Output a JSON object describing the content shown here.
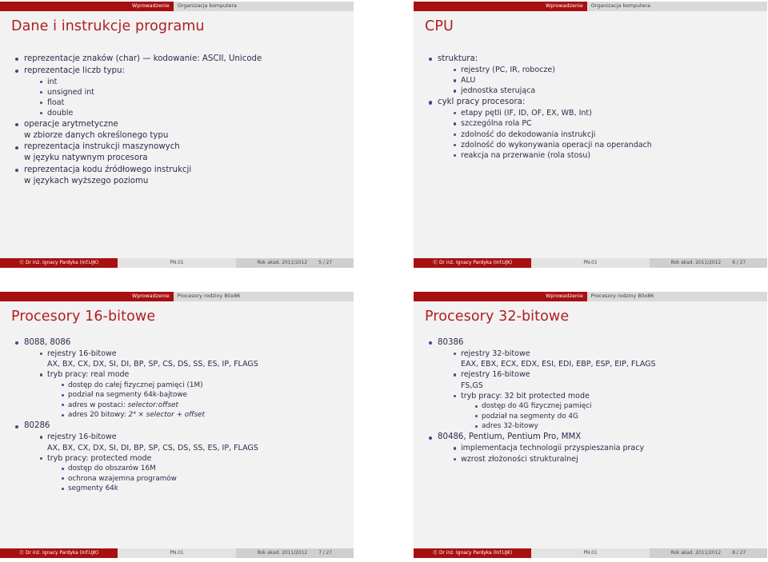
{
  "colors": {
    "accent_red": "#a81010",
    "title_red": "#b02020",
    "body_navy": "#2b2b4f",
    "bullet_navy": "#46468c",
    "slide_bg": "#f2f2f2",
    "page_bg": "#ffffff",
    "nav_inactive_bg": "#d9d9d9"
  },
  "footer_common": {
    "author": "Ⓒ Dr inż. Ignacy Pardyka  (Inf.UJK)",
    "short_title": "PN.01",
    "date": "Rok akad. 2011/2012"
  },
  "slides": [
    {
      "id": "slide-5",
      "nav": [
        {
          "label": "Wprowadzenie",
          "active": true
        },
        {
          "label": "Organizacja komputera",
          "active": false
        }
      ],
      "title": "Dane i instrukcje programu",
      "items": [
        {
          "text": "reprezentacje znaków (char) — kodowanie: ASCII, Unicode"
        },
        {
          "text": "reprezentacje liczb typu:",
          "children": [
            {
              "text": "int"
            },
            {
              "text": "unsigned int"
            },
            {
              "text": "float"
            },
            {
              "text": "double"
            }
          ]
        },
        {
          "text": "operacje arytmetyczne",
          "subline": "w zbiorze danych określonego typu"
        },
        {
          "text": "reprezentacja instrukcji maszynowych",
          "subline": "w języku natywnym procesora"
        },
        {
          "text": "reprezentacja kodu źródłowego instrukcji",
          "subline": "w językach wyższego poziomu"
        }
      ],
      "footer": {
        "page": "5 / 27"
      }
    },
    {
      "id": "slide-6",
      "nav": [
        {
          "label": "Wprowadzenie",
          "active": true
        },
        {
          "label": "Organizacja komputera",
          "active": false
        }
      ],
      "title": "CPU",
      "items": [
        {
          "text": "struktura:",
          "children": [
            {
              "text": "rejestry (PC, IR, robocze)"
            },
            {
              "text": "ALU"
            },
            {
              "text": "jednostka sterująca"
            }
          ]
        },
        {
          "text": "cykl pracy procesora:",
          "children": [
            {
              "text": "etapy pętli (IF, ID, OF, EX, WB, Int)"
            },
            {
              "text": "szczególna rola PC"
            },
            {
              "text": "zdolność do dekodowania instrukcji"
            },
            {
              "text": "zdolność do wykonywania operacji na operandach"
            },
            {
              "text": "reakcja na przerwanie (rola stosu)"
            }
          ]
        }
      ],
      "footer": {
        "page": "6 / 27"
      }
    },
    {
      "id": "slide-7",
      "nav": [
        {
          "label": "Wprowadzenie",
          "active": true
        },
        {
          "label": "Procesory rodziny 80x86",
          "active": false
        }
      ],
      "title": "Procesory 16-bitowe",
      "items": [
        {
          "text": "8088, 8086",
          "children": [
            {
              "text": "rejestry 16-bitowe",
              "subline": "AX, BX, CX, DX, SI, DI, BP, SP, CS, DS, SS, ES, IP, FLAGS"
            },
            {
              "text": "tryb pracy: real mode",
              "children": [
                {
                  "text": "dostęp do całej fizycznej pamięci (1M)"
                },
                {
                  "text": "podział na segmenty 64k-bajtowe"
                },
                {
                  "text": "adres w postaci: ",
                  "italic_tail": "selector:offset"
                },
                {
                  "text": "adres 20 bitowy: ",
                  "math": "2⁴ × selector + offset"
                }
              ]
            }
          ]
        },
        {
          "text": "80286",
          "children": [
            {
              "text": "rejestry 16-bitowe",
              "subline": "AX, BX, CX, DX, SI, DI, BP, SP, CS, DS, SS, ES, IP, FLAGS"
            },
            {
              "text": "tryb pracy: protected mode",
              "children": [
                {
                  "text": "dostęp do obszarów 16M"
                },
                {
                  "text": "ochrona wzajemna programów"
                },
                {
                  "text": "segmenty 64k"
                }
              ]
            }
          ]
        }
      ],
      "footer": {
        "page": "7 / 27"
      }
    },
    {
      "id": "slide-8",
      "nav": [
        {
          "label": "Wprowadzenie",
          "active": true
        },
        {
          "label": "Procesory rodziny 80x86",
          "active": false
        }
      ],
      "title": "Procesory 32-bitowe",
      "items": [
        {
          "text": "80386",
          "children": [
            {
              "text": "rejestry 32-bitowe",
              "subline": "EAX, EBX, ECX, EDX, ESI, EDI, EBP, ESP, EIP, FLAGS"
            },
            {
              "text": "rejestry 16-bitowe",
              "subline": "FS,GS"
            },
            {
              "text": "tryb pracy: 32 bit protected mode",
              "children": [
                {
                  "text": "dostęp do 4G fizycznej pamięci"
                },
                {
                  "text": "podział na segmenty do 4G"
                },
                {
                  "text": "adres 32-bitowy"
                }
              ]
            }
          ]
        },
        {
          "text": "80486, Pentium, Pentium Pro, MMX",
          "children": [
            {
              "text": "implementacja technologii przyspieszania pracy"
            },
            {
              "text": "wzrost złożoności strukturalnej"
            }
          ]
        }
      ],
      "footer": {
        "page": "8 / 27"
      }
    }
  ]
}
